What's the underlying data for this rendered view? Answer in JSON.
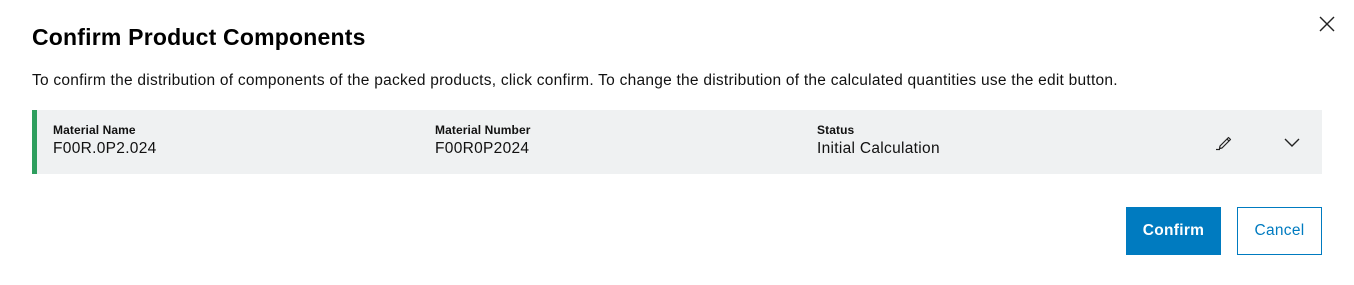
{
  "dialog": {
    "title": "Confirm Product Components",
    "description": "To confirm the distribution of components of the packed products, click confirm. To change the distribution of the calculated quantities use the edit button.",
    "close_icon": "close-icon"
  },
  "component": {
    "material_name_label": "Material Name",
    "material_name_value": "F00R.0P2.024",
    "material_number_label": "Material Number",
    "material_number_value": "F00R0P2024",
    "status_label": "Status",
    "status_value": "Initial Calculation",
    "edit_icon": "pencil-icon",
    "expand_icon": "chevron-down-icon",
    "accent_color": "#2e9e5e"
  },
  "actions": {
    "confirm_label": "Confirm",
    "cancel_label": "Cancel",
    "primary_color": "#007bc0"
  }
}
